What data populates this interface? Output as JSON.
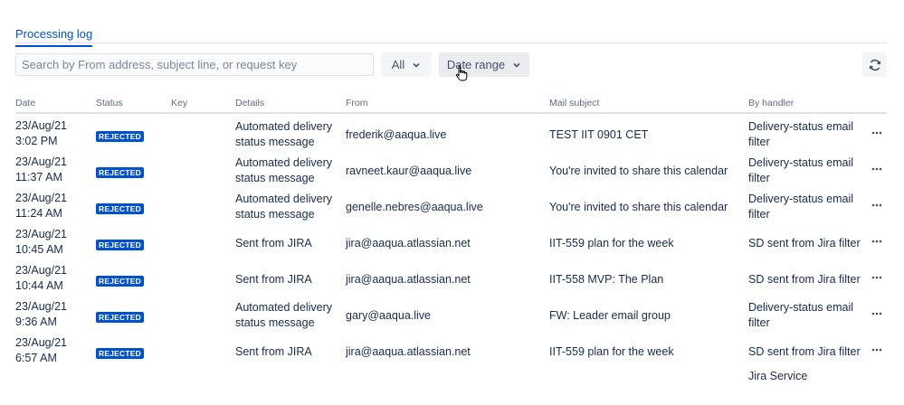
{
  "tabs": {
    "processing_log": "Processing log"
  },
  "toolbar": {
    "search_placeholder": "Search by From address, subject line, or request key",
    "filter_all": "All",
    "date_range": "Date range"
  },
  "table": {
    "headers": {
      "date": "Date",
      "status": "Status",
      "key": "Key",
      "details": "Details",
      "from": "From",
      "subject": "Mail subject",
      "handler": "By handler"
    },
    "rows": [
      {
        "date": "23/Aug/21 3:02 PM",
        "status": "REJECTED",
        "key": "",
        "details": "Automated delivery status message",
        "from": "frederik@aaqua.live",
        "subject": "TEST IIT 0901 CET",
        "handler": "Delivery-status email filter"
      },
      {
        "date": "23/Aug/21 11:37 AM",
        "status": "REJECTED",
        "key": "",
        "details": "Automated delivery status message",
        "from": "ravneet.kaur@aaqua.live",
        "subject": "You're invited to share this calendar",
        "handler": "Delivery-status email filter"
      },
      {
        "date": "23/Aug/21 11:24 AM",
        "status": "REJECTED",
        "key": "",
        "details": "Automated delivery status message",
        "from": "genelle.nebres@aaqua.live",
        "subject": "You're invited to share this calendar",
        "handler": "Delivery-status email filter"
      },
      {
        "date": "23/Aug/21 10:45 AM",
        "status": "REJECTED",
        "key": "",
        "details": "Sent from JIRA",
        "from": "jira@aaqua.atlassian.net",
        "subject": "IIT-559 plan for the week",
        "handler": "SD sent from Jira filter"
      },
      {
        "date": "23/Aug/21 10:44 AM",
        "status": "REJECTED",
        "key": "",
        "details": "Sent from JIRA",
        "from": "jira@aaqua.atlassian.net",
        "subject": "IIT-558 MVP: The Plan",
        "handler": "SD sent from Jira filter"
      },
      {
        "date": "23/Aug/21 9:36 AM",
        "status": "REJECTED",
        "key": "",
        "details": "Automated delivery status message",
        "from": "gary@aaqua.live",
        "subject": "FW: Leader email group",
        "handler": "Delivery-status email filter"
      },
      {
        "date": "23/Aug/21 6:57 AM",
        "status": "REJECTED",
        "key": "",
        "details": "Sent from JIRA",
        "from": "jira@aaqua.atlassian.net",
        "subject": "IIT-559 plan for the week",
        "handler": "SD sent from Jira filter"
      }
    ],
    "partial_next_row_handler": "Jira Service"
  },
  "icons": {
    "refresh": "refresh-icon",
    "more": "more-actions-icon",
    "chevron": "chevron-down-icon",
    "cursor": "hand-pointer-cursor"
  },
  "colors": {
    "accent": "#0052CC",
    "lozenge": "#0052CC",
    "text": "#172B4D",
    "muted": "#5E6C84"
  }
}
